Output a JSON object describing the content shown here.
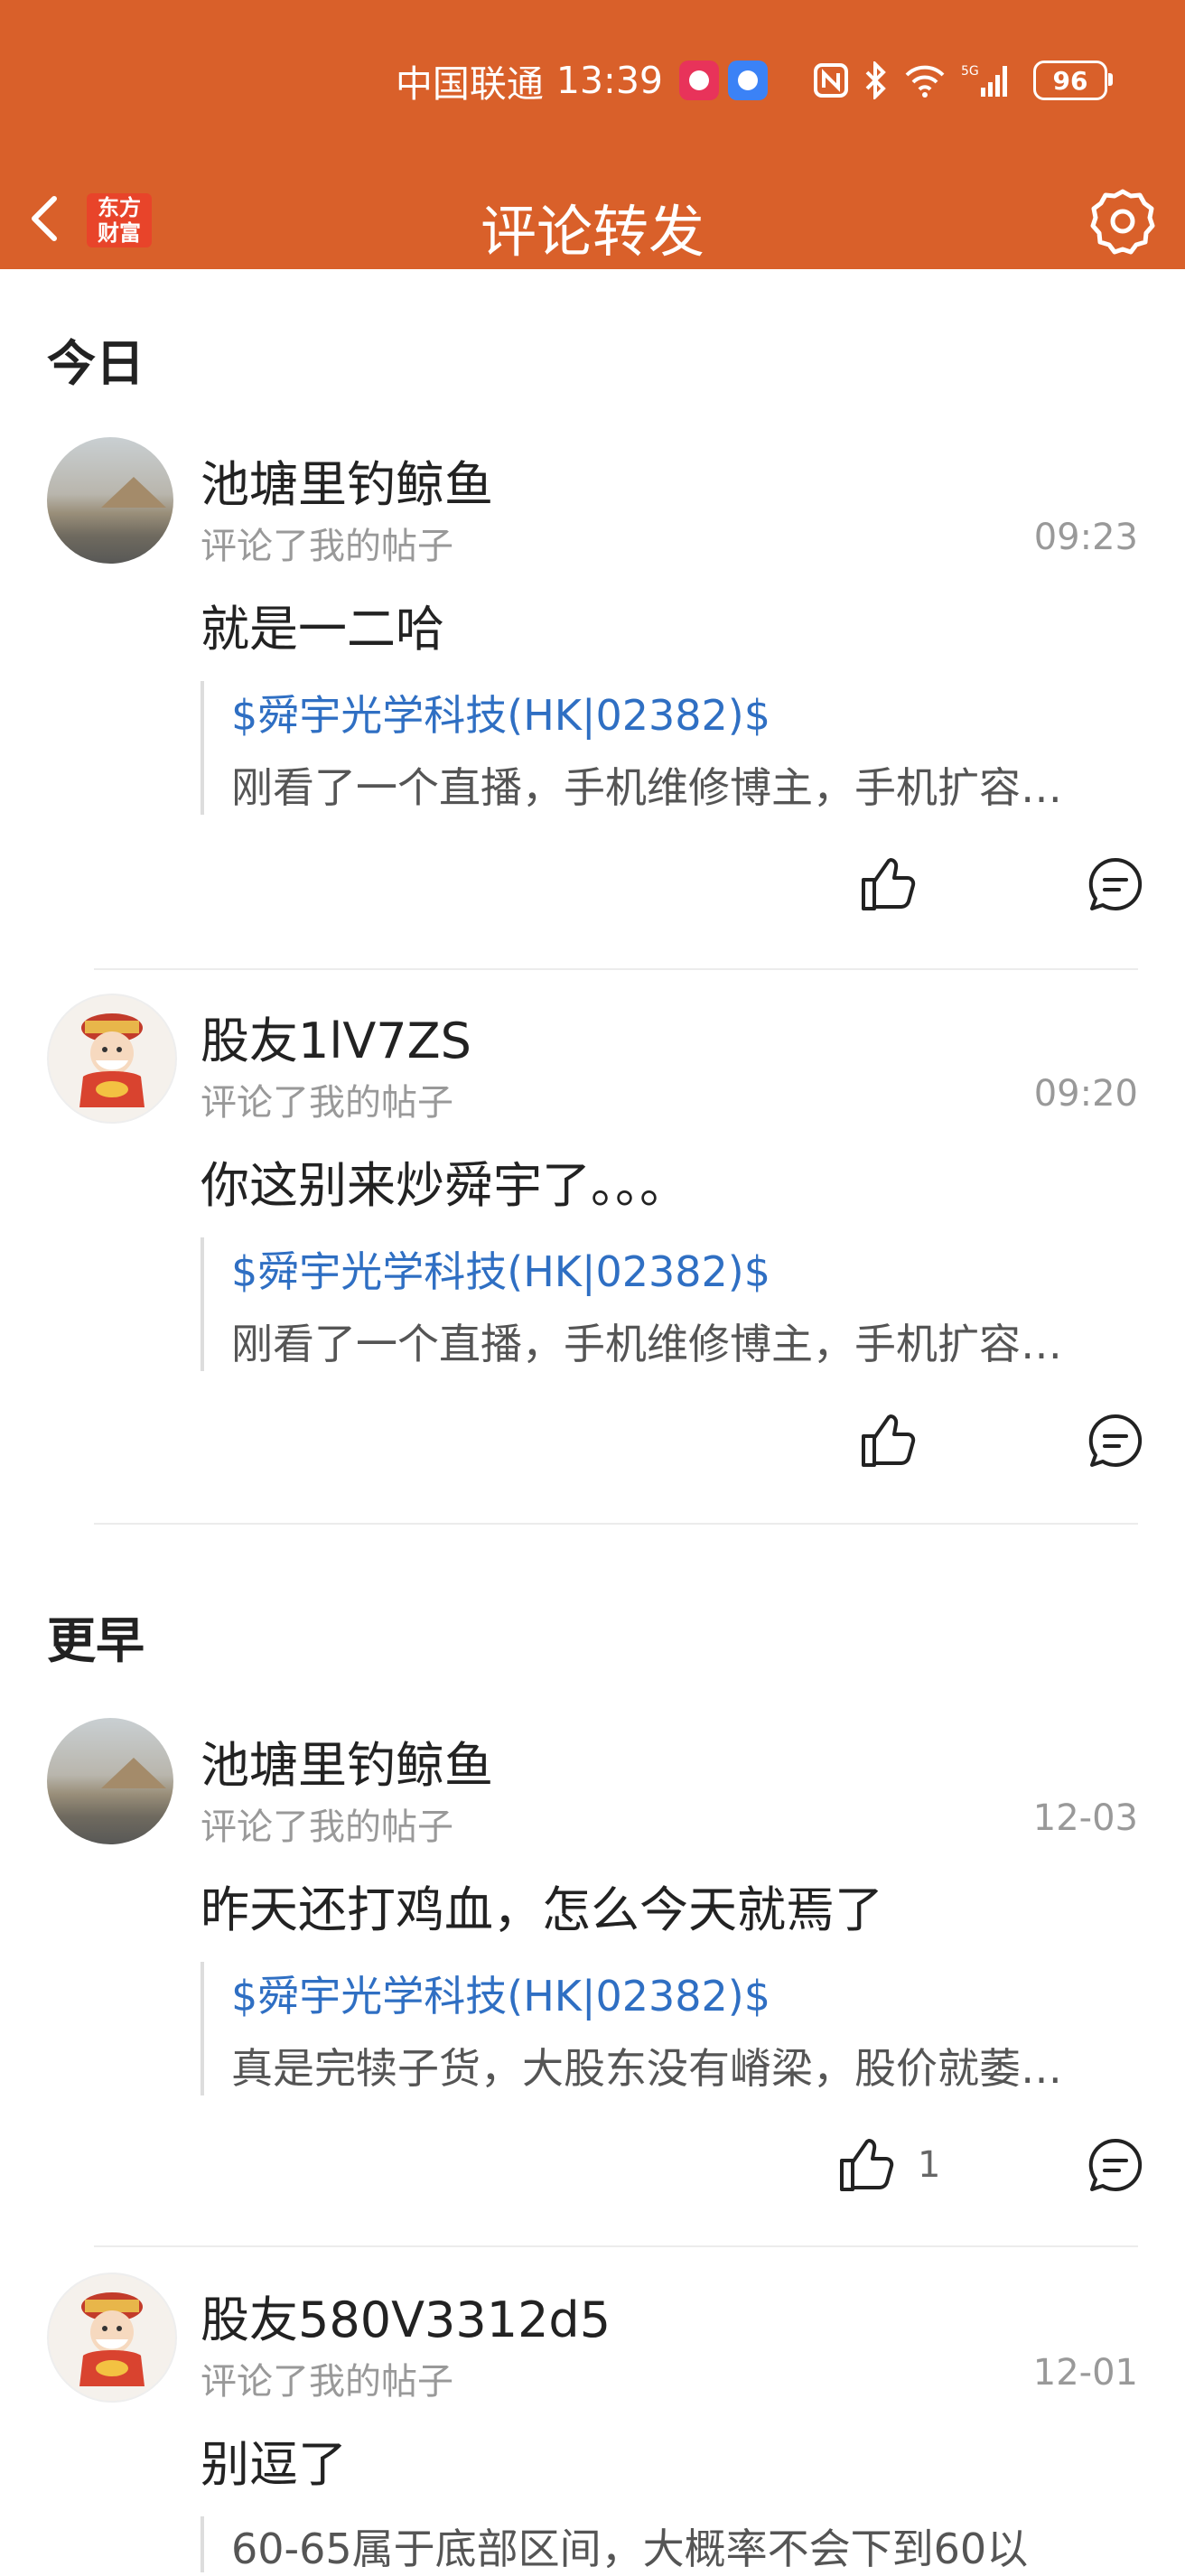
{
  "status_bar": {
    "carrier": "中国联通",
    "time": "13:39",
    "battery": "96"
  },
  "nav": {
    "logo_line1": "东方",
    "logo_line2": "财富",
    "title": "评论转发"
  },
  "sections": {
    "today": "今日",
    "earlier": "更早"
  },
  "items": [
    {
      "username": "池塘里钓鲸鱼",
      "action": "评论了我的帖子",
      "time": "09:23",
      "comment": "就是一二哈",
      "stock": "$舜宇光学科技(HK|02382)$",
      "excerpt": "刚看了一个直播，手机维修博主，手机扩容…",
      "likes": ""
    },
    {
      "username": "股友1lV7ZS",
      "action": "评论了我的帖子",
      "time": "09:20",
      "comment": "你这别来炒舜宇了。。。",
      "stock": "$舜宇光学科技(HK|02382)$",
      "excerpt": "刚看了一个直播，手机维修博主，手机扩容…",
      "likes": ""
    },
    {
      "username": "池塘里钓鲸鱼",
      "action": "评论了我的帖子",
      "time": "12-03",
      "comment": "昨天还打鸡血，怎么今天就焉了",
      "stock": "$舜宇光学科技(HK|02382)$",
      "excerpt": "真是完犊子货，大股东没有嵴梁，股价就萎…",
      "likes": "1"
    },
    {
      "username": "股友580V3312d5",
      "action": "评论了我的帖子",
      "time": "12-01",
      "comment": "别逗了",
      "stock": "",
      "excerpt": "60-65属于底部区间，大概率不会下到60以",
      "likes": ""
    }
  ],
  "colors": {
    "brand": "#d9602a",
    "stock_link": "#2f6fc3"
  }
}
